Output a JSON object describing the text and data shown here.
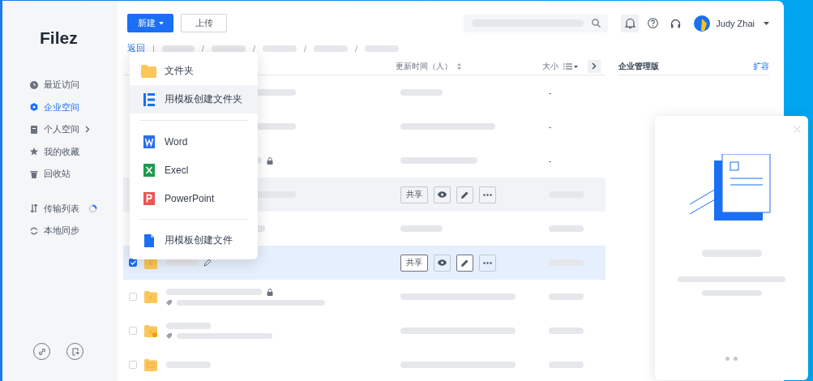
{
  "logo": "Filez",
  "sidebar": {
    "items": [
      {
        "label": "最近访问",
        "selected": false
      },
      {
        "label": "企业空间",
        "selected": true
      },
      {
        "label": "个人空间",
        "selected": false,
        "expandable": true
      },
      {
        "label": "我的收藏",
        "selected": false
      },
      {
        "label": "回收站",
        "selected": false
      }
    ],
    "tools": [
      {
        "label": "传输列表",
        "busy": true
      },
      {
        "label": "本地同步",
        "busy": false
      }
    ]
  },
  "toolbar": {
    "new_button": "新建",
    "upload_button": "上传",
    "user_name": "Judy Zhai"
  },
  "breadcrumb": {
    "back": "返回",
    "divider": "|",
    "separators": [
      "/",
      "/",
      "/",
      "/"
    ]
  },
  "table": {
    "columns": [
      "更新时间（人）",
      "大小"
    ],
    "rows": [
      {
        "selected": false,
        "hovered": false,
        "size": "-"
      },
      {
        "selected": false,
        "hovered": false,
        "size": "-"
      },
      {
        "selected": false,
        "hovered": false,
        "size": "-",
        "locked": true
      },
      {
        "selected": false,
        "hovered": true,
        "share": "共享"
      },
      {
        "selected": false,
        "hovered": false
      },
      {
        "selected": true,
        "hovered": false,
        "share": "共享",
        "editable": true
      },
      {
        "selected": false,
        "hovered": false,
        "locked": true,
        "tagged": true
      },
      {
        "selected": false,
        "hovered": false,
        "tagged": true
      },
      {
        "selected": false,
        "hovered": false
      }
    ]
  },
  "side_panel": {
    "title": "企业管理版",
    "link": "扩容"
  },
  "menu": {
    "groups": [
      [
        {
          "label": "文件夹",
          "highlighted": false
        },
        {
          "label": "用模板创建文件夹",
          "highlighted": true
        }
      ],
      [
        {
          "label": "Word",
          "highlighted": false
        },
        {
          "label": "Execl",
          "highlighted": false
        },
        {
          "label": "PowerPoint",
          "highlighted": false
        }
      ],
      [
        {
          "label": "用模板创建文件",
          "highlighted": false
        }
      ]
    ]
  }
}
